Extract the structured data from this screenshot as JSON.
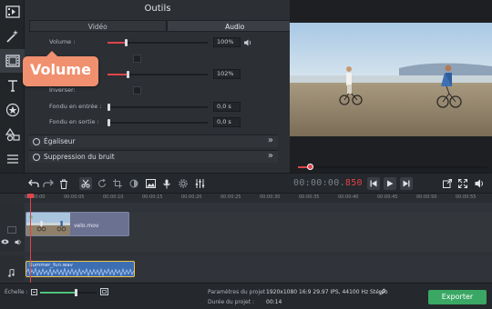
{
  "sidebar": {
    "items": [
      {
        "icon": "film-import-icon"
      },
      {
        "icon": "magic-wand-icon"
      },
      {
        "icon": "film-clip-icon"
      },
      {
        "icon": "text-titles-icon"
      },
      {
        "icon": "star-stickers-icon"
      },
      {
        "icon": "shapes-transitions-icon"
      },
      {
        "icon": "list-menu-icon"
      }
    ]
  },
  "tools": {
    "title": "Outils",
    "tabs": [
      "Vidéo",
      "Audio"
    ],
    "active_tab": 1,
    "volume": {
      "label": "Volume :",
      "value": "100%",
      "level": 0.18
    },
    "row2_value": "102%",
    "row2_level": 0.2,
    "inverser": {
      "label": "Inverser:"
    },
    "fade_in": {
      "label": "Fondu en entrée :",
      "value": "0,0 s"
    },
    "fade_out": {
      "label": "Fondu en sortie :",
      "value": "0,0 s"
    },
    "sections": [
      "Égaliseur",
      "Suppression du bruit"
    ],
    "tooltip": "Volume"
  },
  "preview": {
    "progress": 0.06
  },
  "toolbar": {
    "timer_main": "00:00:00.",
    "timer_ms": "850"
  },
  "timeline": {
    "ticks": [
      "00:00:00",
      "00:00:05",
      "00:00:10",
      "00:00:15",
      "00:00:20",
      "00:00:25",
      "00:00:30",
      "00:00:35",
      "00:00:40",
      "00:00:45",
      "00:00:50",
      "00:00:55"
    ],
    "video_clip": "velo.mov",
    "audio_clip": "Summer_fun.wav"
  },
  "status": {
    "scale_label": "Échelle :",
    "params_label": "Paramètres du projet :",
    "params_value": "1920x1080 16:9 29.97 IPS, 44100 Hz Stéréo",
    "duration_label": "Durée du projet :",
    "duration_value": "00:14",
    "export_label": "Exporter"
  },
  "colors": {
    "accent_red": "#e0444b",
    "tooltip": "#f0906f",
    "export_green": "#3aa864",
    "audio_clip": "#3d6eb2",
    "video_clip": "#6b7191"
  }
}
